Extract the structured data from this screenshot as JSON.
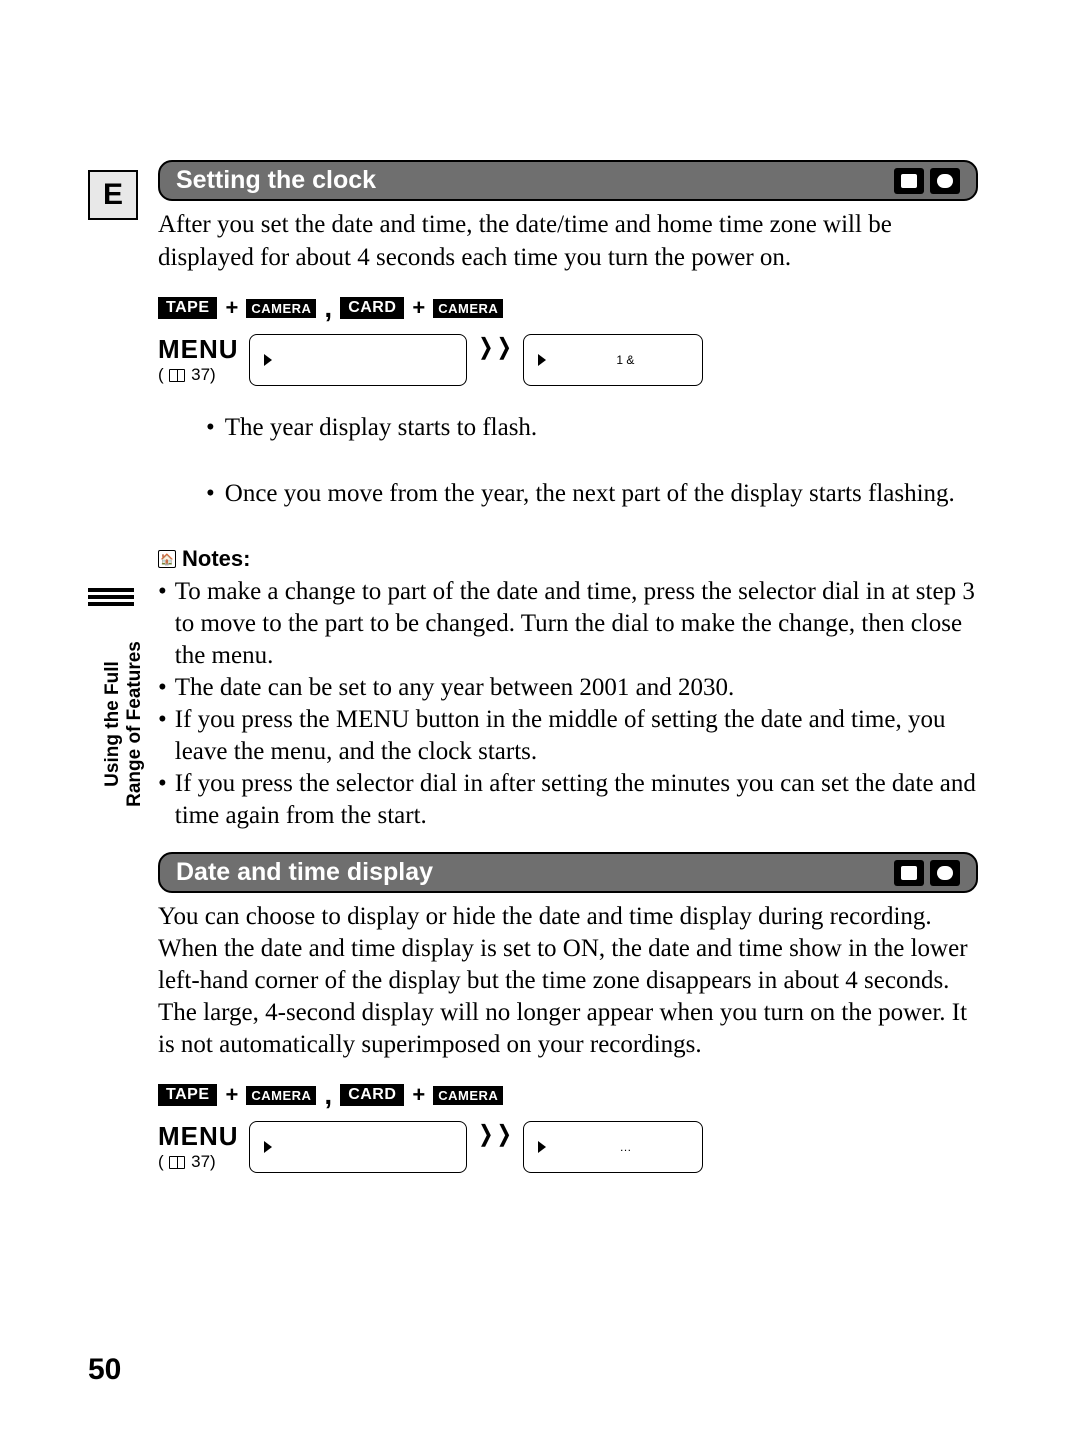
{
  "language_badge": "E",
  "sidebar_label": "Using the Full\nRange of Features",
  "section1": {
    "title": "Setting the clock",
    "intro": "After you set the date and time, the date/time and home time zone will be displayed for about 4 seconds each time you turn the power on."
  },
  "badges": {
    "tape": "TAPE",
    "camera": "CAMERA",
    "card": "CARD"
  },
  "menu": {
    "label": "MENU",
    "ref_num": "37"
  },
  "menu_box2_text": "1 &",
  "steps": [
    "The year display starts to flash.",
    "Once you move from the year, the next part of the display starts flashing."
  ],
  "notes": {
    "heading": "Notes:",
    "items": [
      "To make a change to part of the date and time, press the selector dial in at step 3 to move to the part to be changed. Turn the dial to make the change, then close the menu.",
      "The date can be set to any year between 2001 and 2030.",
      "If you press the MENU button in the middle of setting the date and time, you leave the menu, and the clock starts.",
      "If you press the selector dial in after setting the minutes you can set the date and time again from the start."
    ]
  },
  "section2": {
    "title": "Date and time display",
    "body": "You can choose to display or hide the date and time display during recording. When the date and time display is set to ON, the date and time show in the lower left-hand corner of the display but the time zone disappears in about 4 seconds. The large, 4-second display will no longer appear when you turn on the power. It is not automatically superimposed on your recordings."
  },
  "menu_box2b_text": "…",
  "page_number": "50"
}
